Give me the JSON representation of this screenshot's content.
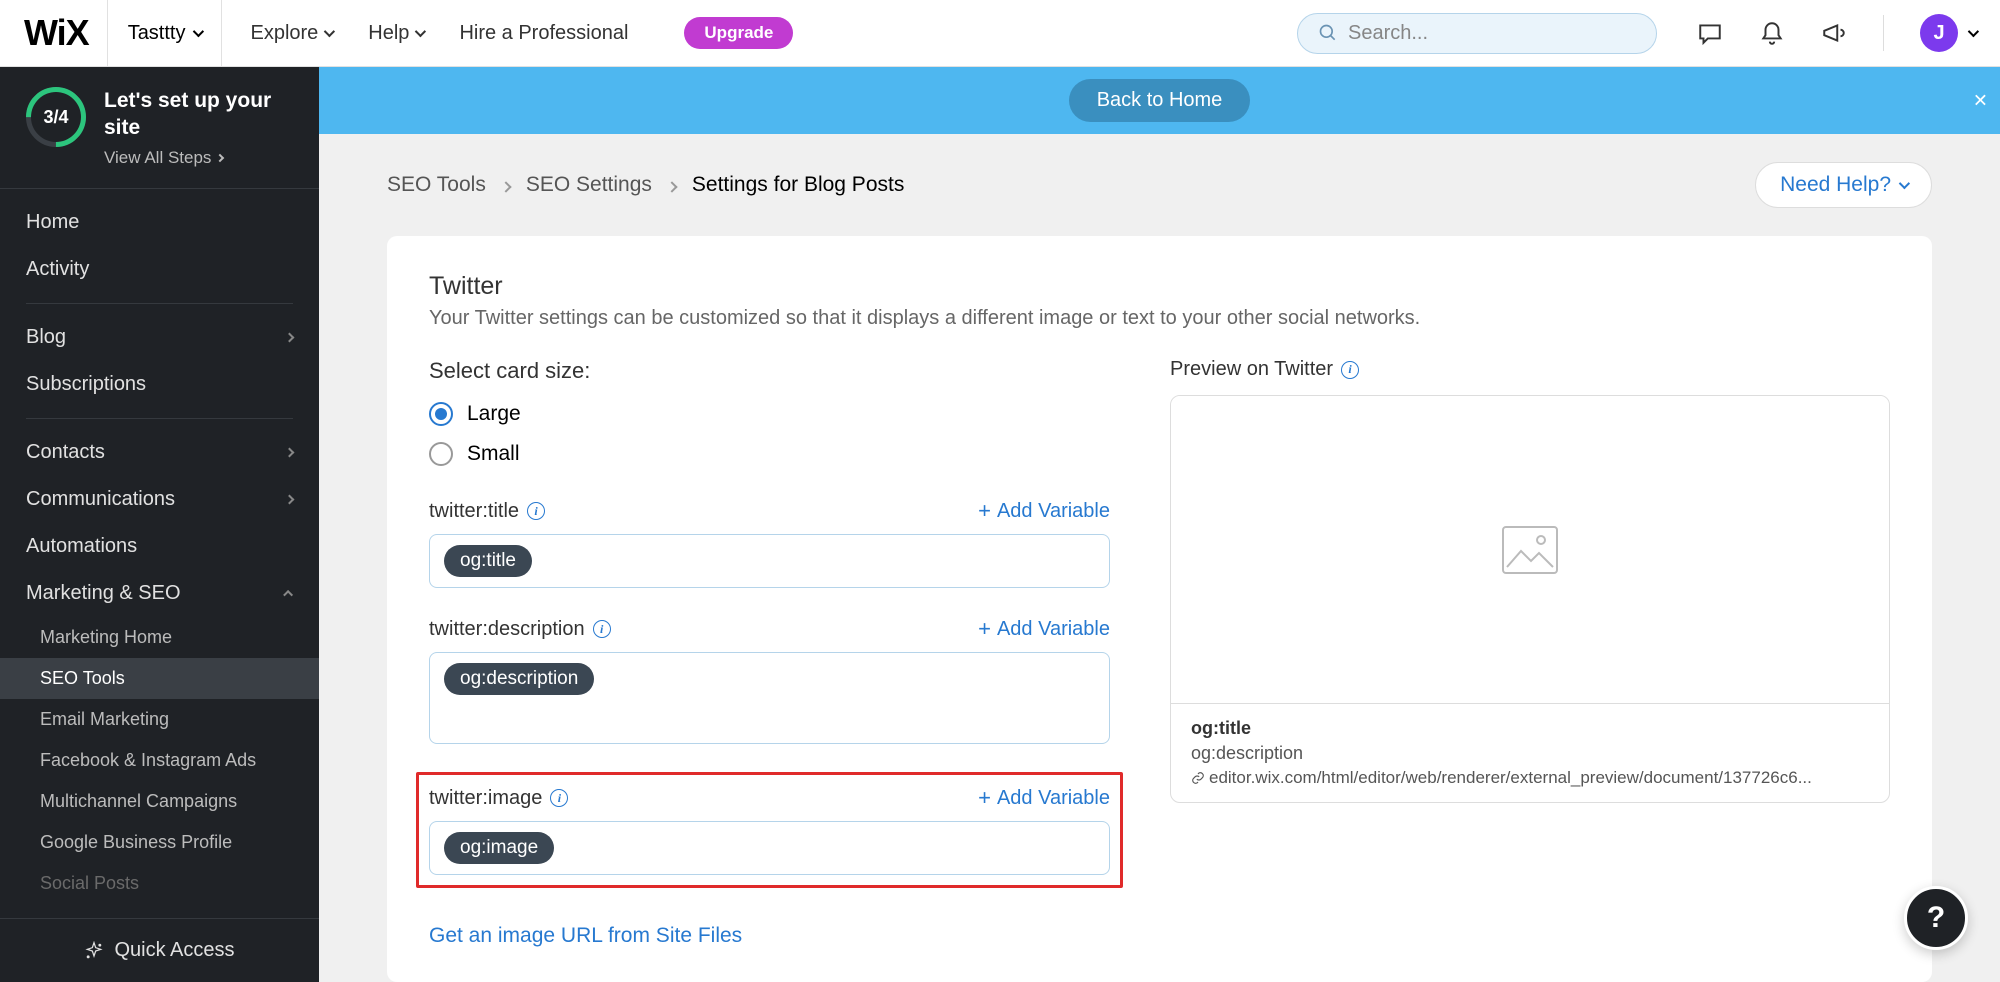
{
  "topnav": {
    "logo": "WiX",
    "site_name": "Tasttty",
    "menu": {
      "explore": "Explore",
      "help": "Help",
      "hire": "Hire a Professional"
    },
    "upgrade": "Upgrade",
    "search_placeholder": "Search...",
    "avatar_letter": "J"
  },
  "sidebar": {
    "setup": {
      "progress": "3/4",
      "title": "Let's set up your site",
      "view_all": "View All Steps"
    },
    "home": "Home",
    "activity": "Activity",
    "blog": "Blog",
    "subscriptions": "Subscriptions",
    "contacts": "Contacts",
    "communications": "Communications",
    "automations": "Automations",
    "marketing_seo": "Marketing & SEO",
    "sub": {
      "marketing_home": "Marketing Home",
      "seo_tools": "SEO Tools",
      "email_marketing": "Email Marketing",
      "fb_ig_ads": "Facebook & Instagram Ads",
      "multichannel": "Multichannel Campaigns",
      "google_business": "Google Business Profile",
      "social_posts": "Social Posts"
    },
    "quick_access": "Quick Access"
  },
  "banner": {
    "back_home": "Back to Home"
  },
  "breadcrumb": {
    "seo_tools": "SEO Tools",
    "seo_settings": "SEO Settings",
    "blog_posts": "Settings for Blog Posts"
  },
  "help_button": "Need Help?",
  "section": {
    "title": "Twitter",
    "desc": "Your Twitter settings can be customized so that it displays a different image or text to your other social networks."
  },
  "card_size": {
    "label": "Select card size:",
    "large": "Large",
    "small": "Small"
  },
  "fields": {
    "twitter_title": {
      "label": "twitter:title",
      "tag": "og:title",
      "add_var": "Add Variable"
    },
    "twitter_desc": {
      "label": "twitter:description",
      "tag": "og:description",
      "add_var": "Add Variable"
    },
    "twitter_image": {
      "label": "twitter:image",
      "tag": "og:image",
      "add_var": "Add Variable"
    },
    "image_url_link": "Get an image URL from Site Files"
  },
  "preview": {
    "label": "Preview on Twitter",
    "title": "og:title",
    "desc": "og:description",
    "url": "editor.wix.com/html/editor/web/renderer/external_preview/document/137726c6..."
  },
  "fab": "?"
}
